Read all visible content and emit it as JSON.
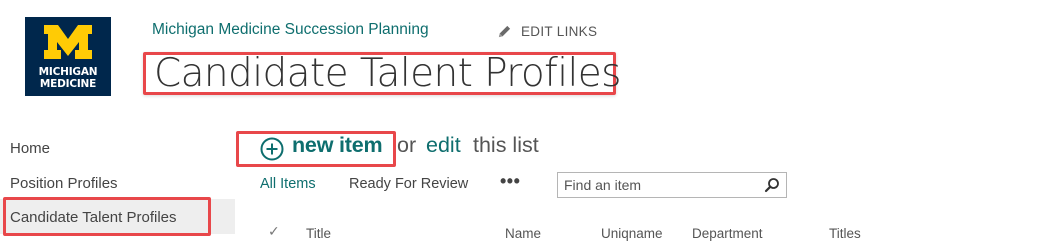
{
  "logo": {
    "line1": "MICHIGAN",
    "line2": "MEDICINE",
    "brand_color": "#00274c",
    "accent_color": "#ffcb05"
  },
  "header": {
    "site_title": "Michigan Medicine Succession Planning",
    "edit_links_label": "EDIT LINKS",
    "edit_icon": "pencil-icon",
    "page_title": "Candidate Talent Profiles"
  },
  "nav": {
    "items": [
      {
        "label": "Home"
      },
      {
        "label": "Position Profiles"
      },
      {
        "label": "Candidate Talent Profiles",
        "selected": true
      }
    ]
  },
  "list": {
    "new_item_label": "new item",
    "new_item_icon": "plus-circle-icon",
    "or_text": "or",
    "edit_label": "edit",
    "this_list_text": "this list",
    "views": [
      {
        "label": "All Items",
        "active": true
      },
      {
        "label": "Ready For Review",
        "active": false
      }
    ],
    "more_label": "•••",
    "search_placeholder": "Find an item",
    "search_icon": "search-icon",
    "columns": [
      "Title",
      "Name",
      "Uniqname",
      "Department",
      "Titles"
    ]
  },
  "colors": {
    "highlight_border": "#e8474a",
    "link_teal": "#0e6e6e",
    "nav_selected_bg": "#eeeeee"
  }
}
